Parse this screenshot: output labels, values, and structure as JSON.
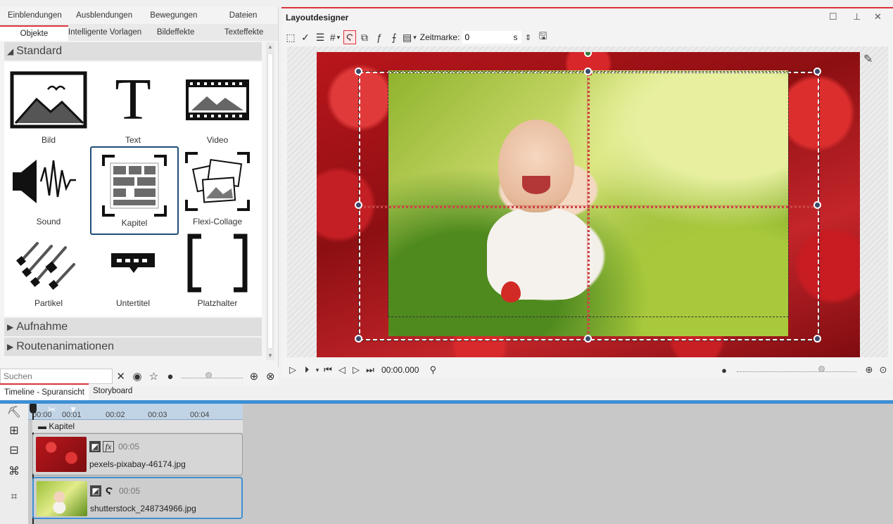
{
  "toolbox": {
    "tabs_row1": [
      "Einblendungen",
      "Ausblendungen",
      "Bewegungen",
      "Dateien"
    ],
    "tabs_row2": [
      "Objekte",
      "Intelligente Vorlagen",
      "Bildeffekte",
      "Texteffekte"
    ],
    "active_tab": "Objekte",
    "section_standard": "Standard",
    "section_aufnahme": "Aufnahme",
    "section_routen": "Routenanimationen",
    "items": [
      {
        "label": "Bild",
        "icon": "image-icon"
      },
      {
        "label": "Text",
        "icon": "text-icon"
      },
      {
        "label": "Video",
        "icon": "film-icon"
      },
      {
        "label": "Sound",
        "icon": "speaker-wave-icon"
      },
      {
        "label": "Kapitel",
        "icon": "chapter-icon",
        "selected": true
      },
      {
        "label": "Flexi-Collage",
        "icon": "collage-icon"
      },
      {
        "label": "Partikel",
        "icon": "particles-icon"
      },
      {
        "label": "Untertitel",
        "icon": "subtitle-icon"
      },
      {
        "label": "Platzhalter",
        "icon": "placeholder-icon"
      }
    ],
    "search_placeholder": "Suchen"
  },
  "designer": {
    "title": "Layoutdesigner",
    "zeitmarke_label": "Zeitmarke:",
    "zeitmarke_value": "0",
    "zeitmarke_unit": "s",
    "timecode": "00:00.000",
    "accent_color": "#d9343a"
  },
  "timeline": {
    "tabs": [
      "Timeline - Spuransicht",
      "Storyboard"
    ],
    "active_tab": "Timeline - Spuransicht",
    "ruler": [
      "00:00",
      "00:01",
      "00:02",
      "00:03",
      "00:04"
    ],
    "track_title": "Kapitel",
    "clips": [
      {
        "duration": "00:05",
        "filename": "pexels-pixabay-46174.jpg"
      },
      {
        "duration": "00:05",
        "filename": "shutterstock_248734966.jpg"
      }
    ]
  }
}
